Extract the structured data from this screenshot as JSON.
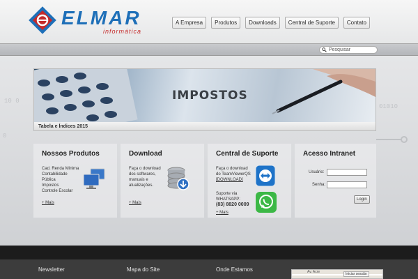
{
  "header": {
    "brand_name": "ELMAR",
    "brand_sub": "informática",
    "nav": [
      "A Empresa",
      "Produtos",
      "Downloads",
      "Central de Suporte",
      "Contato"
    ]
  },
  "search": {
    "placeholder": "Pesquisar"
  },
  "banner": {
    "title": "IMPOSTOS",
    "caption": "Tabela e Índices 2015"
  },
  "panels": {
    "produtos": {
      "title": "Nossos Produtos",
      "items": [
        "Cad. Renda Mínima",
        "Contabilidade",
        "Pública",
        "Impostos",
        "Controle Escolar"
      ],
      "more": "+ Mais"
    },
    "download": {
      "title": "Download",
      "lines": [
        "Faça o download",
        "dos softwares,",
        "manuais e",
        "atualizações."
      ],
      "more": "+ Mais"
    },
    "suporte": {
      "title": "Central de Suporte",
      "tv_lines": [
        "Faça o download",
        "do TeamViewerQS"
      ],
      "tv_link": "[DOWNLOAD]",
      "wa_lines": [
        "Suporte via",
        "WHATSAPP:"
      ],
      "wa_number": "(83) 8820 0009",
      "more": "+ Mais"
    },
    "intranet": {
      "title": "Acesso Intranet",
      "user_label": "Usuário:",
      "pass_label": "Senha:",
      "login_button": "Login"
    }
  },
  "footer": {
    "newsletter": "Newsletter",
    "sitemap": "Mapa do Site",
    "location": "Onde Estamos",
    "map_street_1": "Av. Acre",
    "map_street_2": "Iniciar sessão"
  },
  "colors": {
    "brand_blue": "#1e6fb8",
    "brand_red": "#c42a2a",
    "footer_dark": "#1c1c1c"
  }
}
